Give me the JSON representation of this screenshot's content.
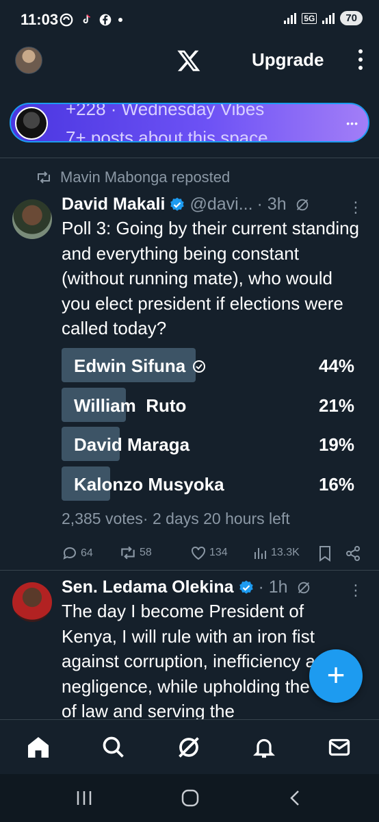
{
  "status_bar": {
    "time": "11:03",
    "network": "5G",
    "battery": "70"
  },
  "topbar": {
    "upgrade_label": "Upgrade"
  },
  "space": {
    "line1": "+228 · Wednesday Vibes",
    "line2": "7+ posts about this space"
  },
  "tweet1": {
    "repost_label": "Mavin Mabonga reposted",
    "name": "David Makali",
    "handle": "@davi...",
    "time": "· 3h",
    "text": "Poll 3: Going by their current standing and everything being constant (without running mate), who would you elect president if elections were called today?",
    "poll": {
      "options": [
        {
          "label": "Edwin Sifuna",
          "pct": "44%",
          "share": 44,
          "winner": true
        },
        {
          "label": "William  Ruto",
          "pct": "21%",
          "share": 21,
          "winner": false
        },
        {
          "label": "David Maraga",
          "pct": "19%",
          "share": 19,
          "winner": false
        },
        {
          "label": "Kalonzo Musyoka",
          "pct": "16%",
          "share": 16,
          "winner": false
        }
      ],
      "footer": "2,385 votes· 2 days 20 hours left"
    },
    "actions": {
      "replies": "64",
      "reposts": "58",
      "likes": "134",
      "views": "13.3K"
    }
  },
  "tweet2": {
    "name": "Sen. Ledama Olekina",
    "time": "· 1h",
    "text": "The day I become President of Kenya, I will rule with an iron fist against corruption, inefficiency and negligence, while upholding the rule of law and serving the"
  },
  "colors": {
    "background": "#15202b",
    "accent": "#1d9bf0",
    "poll_bar": "#3d5466"
  }
}
